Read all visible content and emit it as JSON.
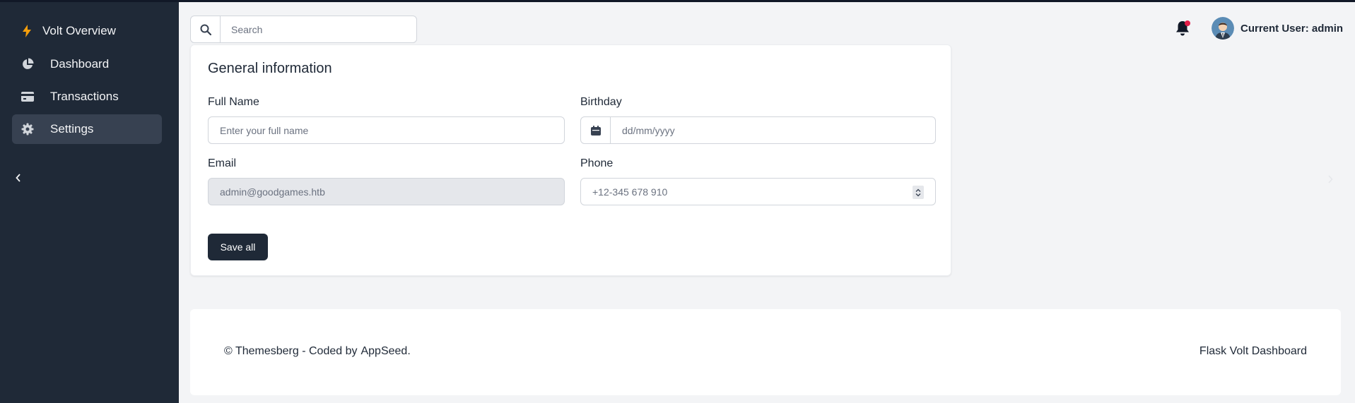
{
  "sidebar": {
    "brand": "Volt Overview",
    "items": [
      {
        "label": "Dashboard",
        "icon": "pie-chart-icon"
      },
      {
        "label": "Transactions",
        "icon": "credit-card-icon"
      },
      {
        "label": "Settings",
        "icon": "gear-icon",
        "active": true
      }
    ]
  },
  "header": {
    "search_placeholder": "Search",
    "user_label": "Current User: admin",
    "notification_dot_color": "#e11d48"
  },
  "form": {
    "title": "General information",
    "full_name_label": "Full Name",
    "full_name_placeholder": "Enter your full name",
    "birthday_label": "Birthday",
    "birthday_placeholder": "dd/mm/yyyy",
    "email_label": "Email",
    "email_value": "admin@goodgames.htb",
    "phone_label": "Phone",
    "phone_placeholder": "+12-345 678 910",
    "save_label": "Save all"
  },
  "footer": {
    "copyright_prefix": "© Themesberg - Coded by",
    "copyright_link": "AppSeed.",
    "right_text": "Flask Volt Dashboard"
  },
  "colors": {
    "sidebar_bg": "#1f2937",
    "page_bg": "#f3f4f6",
    "primary": "#1f2937",
    "brand_bolt": "#f59e0b"
  }
}
